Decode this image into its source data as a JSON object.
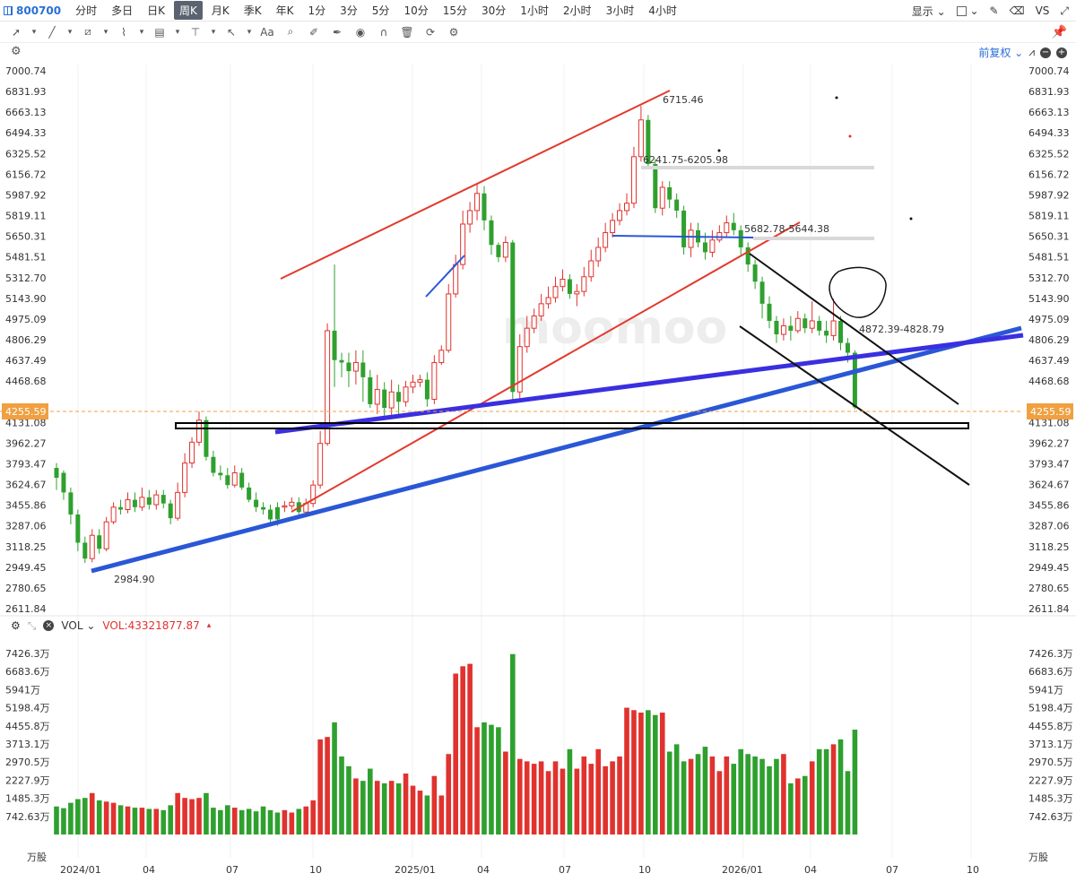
{
  "topbar": {
    "symbol": "800700",
    "periods": [
      "分时",
      "多日",
      "日K",
      "周K",
      "月K",
      "季K",
      "年K",
      "1分",
      "3分",
      "5分",
      "10分",
      "15分",
      "30分",
      "1小时",
      "2小时",
      "3小时",
      "4小时"
    ],
    "active_period": "周K",
    "display_label": "显示",
    "vs_label": "VS"
  },
  "chart_header": {
    "adjust_label": "前复权"
  },
  "price_axis": {
    "ticks": [
      "7000.74",
      "6831.93",
      "6663.13",
      "6494.33",
      "6325.52",
      "6156.72",
      "5987.92",
      "5819.11",
      "5650.31",
      "5481.51",
      "5312.70",
      "5143.90",
      "4975.09",
      "4806.29",
      "4637.49",
      "4468.68",
      "4131.08",
      "3962.27",
      "3793.47",
      "3624.67",
      "3455.86",
      "3287.06",
      "3118.25",
      "2949.45",
      "2780.65",
      "2611.84"
    ],
    "current_price": "4255.59"
  },
  "annotations": {
    "high_label": "6715.46",
    "low_label": "2984.90",
    "zone1": "6241.75-6205.98",
    "zone2": "5682.78-5644.38",
    "zone3": "4872.39-4828.79"
  },
  "watermark": "moomoo",
  "volume": {
    "indicator": "VOL",
    "value_label": "VOL:43321877.87",
    "ticks": [
      "7426.3万",
      "6683.6万",
      "5941万",
      "5198.4万",
      "4455.8万",
      "3713.1万",
      "2970.5万",
      "2227.9万",
      "1485.3万",
      "742.63万",
      "万股"
    ]
  },
  "time_axis": [
    "2024/01",
    "04",
    "07",
    "10",
    "2025/01",
    "04",
    "07",
    "10",
    "2026/01",
    "04",
    "07",
    "10"
  ],
  "chart_data": {
    "type": "candlestick",
    "price_ylim": [
      2611.84,
      7000.74
    ],
    "volume_ylim_wan": [
      0,
      7426.3
    ],
    "current_price": 4255.59,
    "markers": {
      "high": 6715.46,
      "low": 2984.9
    },
    "colors": {
      "up": "#e0322e",
      "down": "#2ea02e"
    },
    "candles": [
      [
        3680,
        3760,
        3580,
        3800,
        1150,
        0
      ],
      [
        3720,
        3560,
        3500,
        3740,
        1080,
        0
      ],
      [
        3560,
        3380,
        3300,
        3600,
        1300,
        0
      ],
      [
        3380,
        3150,
        3080,
        3420,
        1450,
        0
      ],
      [
        3150,
        3020,
        2985,
        3200,
        1500,
        0
      ],
      [
        3020,
        3210,
        2990,
        3260,
        1700,
        1
      ],
      [
        3210,
        3100,
        3060,
        3260,
        1400,
        0
      ],
      [
        3100,
        3320,
        3080,
        3360,
        1350,
        1
      ],
      [
        3320,
        3440,
        3300,
        3480,
        1300,
        1
      ],
      [
        3440,
        3420,
        3380,
        3500,
        1200,
        0
      ],
      [
        3420,
        3500,
        3390,
        3560,
        1150,
        1
      ],
      [
        3500,
        3440,
        3400,
        3560,
        1100,
        0
      ],
      [
        3440,
        3520,
        3410,
        3600,
        1100,
        1
      ],
      [
        3520,
        3460,
        3420,
        3580,
        1050,
        0
      ],
      [
        3460,
        3540,
        3420,
        3580,
        1050,
        1
      ],
      [
        3540,
        3470,
        3430,
        3580,
        1000,
        0
      ],
      [
        3470,
        3350,
        3300,
        3500,
        1200,
        0
      ],
      [
        3350,
        3560,
        3330,
        3640,
        1700,
        1
      ],
      [
        3560,
        3800,
        3520,
        3880,
        1500,
        1
      ],
      [
        3800,
        3970,
        3760,
        4010,
        1450,
        1
      ],
      [
        3970,
        4150,
        3940,
        4220,
        1500,
        1
      ],
      [
        4150,
        3850,
        3820,
        4180,
        1700,
        0
      ],
      [
        3850,
        3720,
        3690,
        3900,
        1100,
        0
      ],
      [
        3720,
        3700,
        3660,
        3780,
        1000,
        0
      ],
      [
        3700,
        3620,
        3590,
        3760,
        1200,
        0
      ],
      [
        3620,
        3720,
        3600,
        3780,
        1100,
        1
      ],
      [
        3720,
        3600,
        3580,
        3760,
        1000,
        0
      ],
      [
        3600,
        3500,
        3480,
        3640,
        1050,
        0
      ],
      [
        3500,
        3440,
        3400,
        3560,
        950,
        0
      ],
      [
        3440,
        3420,
        3380,
        3480,
        1150,
        0
      ],
      [
        3420,
        3340,
        3310,
        3460,
        1000,
        0
      ],
      [
        3340,
        3440,
        3287,
        3480,
        900,
        0
      ],
      [
        3440,
        3450,
        3400,
        3490,
        1000,
        1
      ],
      [
        3450,
        3480,
        3420,
        3520,
        900,
        1
      ],
      [
        3480,
        3400,
        3380,
        3520,
        1050,
        0
      ],
      [
        3400,
        3470,
        3380,
        3510,
        1150,
        1
      ],
      [
        3470,
        3620,
        3440,
        3660,
        1400,
        1
      ],
      [
        3620,
        3960,
        3590,
        4060,
        3900,
        1
      ],
      [
        3960,
        4880,
        3940,
        4940,
        4000,
        1
      ],
      [
        4880,
        4640,
        4420,
        5420,
        4600,
        0
      ],
      [
        4640,
        4620,
        4500,
        4700,
        3200,
        0
      ],
      [
        4620,
        4550,
        4420,
        4700,
        2800,
        0
      ],
      [
        4550,
        4620,
        4440,
        4720,
        2300,
        1
      ],
      [
        4620,
        4500,
        4300,
        4720,
        2200,
        0
      ],
      [
        4500,
        4280,
        4250,
        4560,
        2700,
        0
      ],
      [
        4280,
        4400,
        4200,
        4520,
        2200,
        1
      ],
      [
        4400,
        4250,
        4180,
        4460,
        2100,
        0
      ],
      [
        4250,
        4380,
        4160,
        4480,
        2200,
        1
      ],
      [
        4380,
        4300,
        4200,
        4440,
        2100,
        0
      ],
      [
        4300,
        4420,
        4260,
        4470,
        2500,
        1
      ],
      [
        4420,
        4460,
        4370,
        4520,
        2000,
        1
      ],
      [
        4460,
        4480,
        4420,
        4520,
        1800,
        1
      ],
      [
        4480,
        4320,
        4260,
        4540,
        1600,
        0
      ],
      [
        4320,
        4620,
        4280,
        4680,
        2400,
        1
      ],
      [
        4620,
        4720,
        4600,
        4760,
        1600,
        1
      ],
      [
        4720,
        5180,
        4700,
        5260,
        3300,
        1
      ],
      [
        5180,
        5420,
        5150,
        5500,
        6600,
        1
      ],
      [
        5420,
        5750,
        5380,
        5860,
        6900,
        1
      ],
      [
        5750,
        5860,
        5680,
        5930,
        7000,
        1
      ],
      [
        5860,
        6000,
        5780,
        6080,
        4400,
        1
      ],
      [
        6000,
        5780,
        5700,
        6060,
        4600,
        0
      ],
      [
        5780,
        5580,
        5500,
        5820,
        4500,
        0
      ],
      [
        5580,
        5480,
        5440,
        5600,
        4400,
        0
      ],
      [
        5480,
        5600,
        5440,
        5650,
        3400,
        1
      ],
      [
        5600,
        4380,
        4320,
        5620,
        7400,
        0
      ],
      [
        4380,
        4750,
        4330,
        4850,
        3100,
        1
      ],
      [
        4750,
        4900,
        4700,
        5000,
        3000,
        1
      ],
      [
        4900,
        5000,
        4860,
        5060,
        2900,
        1
      ],
      [
        5000,
        5100,
        4960,
        5180,
        3000,
        1
      ],
      [
        5100,
        5150,
        5060,
        5240,
        2600,
        1
      ],
      [
        5150,
        5240,
        5110,
        5320,
        3000,
        1
      ],
      [
        5240,
        5300,
        5200,
        5380,
        2700,
        1
      ],
      [
        5300,
        5180,
        5140,
        5340,
        3500,
        0
      ],
      [
        5180,
        5200,
        5080,
        5260,
        2700,
        1
      ],
      [
        5200,
        5320,
        5160,
        5400,
        3200,
        1
      ],
      [
        5320,
        5450,
        5280,
        5540,
        2900,
        1
      ],
      [
        5450,
        5560,
        5400,
        5640,
        3500,
        1
      ],
      [
        5560,
        5680,
        5520,
        5760,
        2800,
        1
      ],
      [
        5680,
        5780,
        5640,
        5840,
        3000,
        1
      ],
      [
        5780,
        5860,
        5740,
        5920,
        3200,
        1
      ],
      [
        5860,
        5920,
        5820,
        6000,
        5200,
        1
      ],
      [
        5920,
        6300,
        5880,
        6380,
        5100,
        1
      ],
      [
        6300,
        6600,
        6260,
        6715,
        5000,
        1
      ],
      [
        6600,
        6240,
        6200,
        6640,
        5100,
        0
      ],
      [
        6240,
        5880,
        5840,
        6280,
        4900,
        0
      ],
      [
        5880,
        6050,
        5820,
        6100,
        5000,
        1
      ],
      [
        6050,
        5950,
        5880,
        6100,
        3400,
        0
      ],
      [
        5950,
        5860,
        5800,
        6000,
        3700,
        0
      ],
      [
        5860,
        5560,
        5500,
        5900,
        3000,
        0
      ],
      [
        5560,
        5700,
        5480,
        5760,
        3100,
        1
      ],
      [
        5700,
        5600,
        5560,
        5760,
        3300,
        0
      ],
      [
        5600,
        5520,
        5460,
        5680,
        3600,
        0
      ],
      [
        5520,
        5620,
        5480,
        5700,
        3200,
        1
      ],
      [
        5620,
        5680,
        5600,
        5740,
        2600,
        1
      ],
      [
        5680,
        5760,
        5640,
        5820,
        3200,
        1
      ],
      [
        5760,
        5700,
        5660,
        5840,
        2900,
        0
      ],
      [
        5700,
        5560,
        5500,
        5740,
        3500,
        0
      ],
      [
        5560,
        5420,
        5360,
        5600,
        3300,
        0
      ],
      [
        5420,
        5280,
        5220,
        5460,
        3200,
        0
      ],
      [
        5280,
        5100,
        4980,
        5320,
        3100,
        0
      ],
      [
        5100,
        4960,
        4900,
        5160,
        2800,
        0
      ],
      [
        4960,
        4850,
        4780,
        5000,
        3100,
        0
      ],
      [
        4850,
        4920,
        4800,
        4980,
        3300,
        1
      ],
      [
        4920,
        4880,
        4800,
        5000,
        2100,
        0
      ],
      [
        4880,
        4980,
        4860,
        5040,
        2300,
        1
      ],
      [
        4980,
        4900,
        4860,
        5020,
        2400,
        0
      ],
      [
        4900,
        4960,
        4860,
        5120,
        3000,
        1
      ],
      [
        4960,
        4880,
        4840,
        5000,
        3500,
        0
      ],
      [
        4880,
        4840,
        4780,
        4960,
        3500,
        0
      ],
      [
        4840,
        4960,
        4800,
        5140,
        3700,
        1
      ],
      [
        4960,
        4780,
        4720,
        5000,
        3900,
        0
      ],
      [
        4780,
        4700,
        4620,
        4820,
        2600,
        0
      ],
      [
        4700,
        4255,
        4240,
        4720,
        4300,
        0
      ]
    ]
  }
}
